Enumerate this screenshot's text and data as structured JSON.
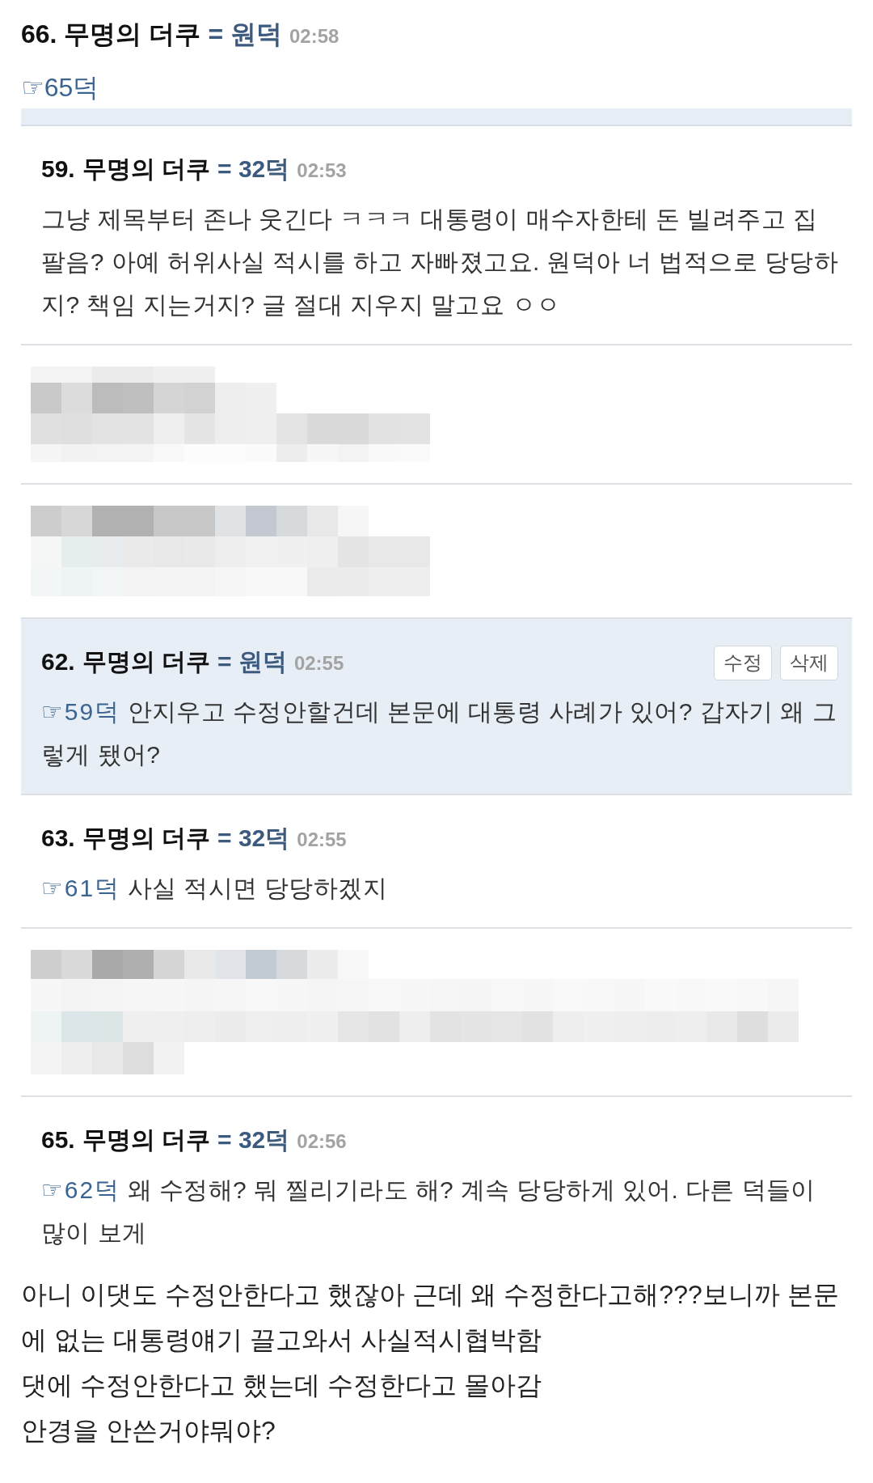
{
  "post": {
    "number": "66.",
    "author": "무명의 더쿠",
    "tag": "= 원덕",
    "time": "02:58",
    "reply_link": "☞65덕"
  },
  "thread": [
    {
      "kind": "comment",
      "highlighted": false,
      "number": "59.",
      "author": "무명의 더쿠",
      "tag": "= 32덕",
      "time": "02:53",
      "body": "그냥 제목부터 존나 웃긴다 ㅋㅋㅋ 대통령이 매수자한테 돈 빌려주고 집 팔음? 아예 허위사실 적시를 하고 자빠졌고요. 원덕아 너 법적으로 당당하지? 책임 지는거지? 글 절대 지우지 말고요 ㅇㅇ"
    },
    {
      "kind": "blurred"
    },
    {
      "kind": "blurred"
    },
    {
      "kind": "comment",
      "highlighted": true,
      "number": "62.",
      "author": "무명의 더쿠",
      "tag": "= 원덕",
      "time": "02:55",
      "actions": [
        "수정",
        "삭제"
      ],
      "reply_link": "☞59덕",
      "body": "안지우고 수정안할건데 본문에 대통령 사례가 있어? 갑자기 왜 그렇게 됐어?"
    },
    {
      "kind": "comment",
      "highlighted": false,
      "number": "63.",
      "author": "무명의 더쿠",
      "tag": "= 32덕",
      "time": "02:55",
      "reply_link": "☞61덕",
      "body": "사실 적시면 당당하겠지"
    },
    {
      "kind": "blurred"
    },
    {
      "kind": "comment",
      "highlighted": false,
      "number": "65.",
      "author": "무명의 더쿠",
      "tag": "= 32덕",
      "time": "02:56",
      "reply_link": "☞62덕",
      "body": "왜 수정해? 뭐 찔리기라도 해? 계속 당당하게 있어. 다른 덕들이 많이 보게"
    }
  ],
  "caption": [
    "아니 이댓도 수정안한다고 했잖아 근데 왜 수정한다고해???보니까 본문에 없는 대통령얘기 끌고와서 사실적시협박함",
    "댓에 수정안한다고 했는데 수정한다고 몰아감",
    "안경을 안쓴거야뭐야?"
  ]
}
